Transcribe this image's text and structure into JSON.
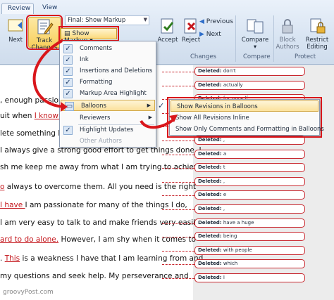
{
  "ribbon": {
    "tabs": [
      {
        "label": "Review"
      },
      {
        "label": "View"
      }
    ],
    "next_label": "Next",
    "track_changes_label": "Track Changes",
    "display_for_review": "Final: Show Markup",
    "show_markup_label": "Show Markup",
    "previous_label": "Previous",
    "next_change_label": "Next",
    "accept_label": "Accept",
    "reject_label": "Reject",
    "changes_group": "Changes",
    "compare_label": "Compare",
    "compare_group": "Compare",
    "block_authors_label": "Block Authors",
    "restrict_editing_label": "Restrict Editing",
    "protect_group": "Protect"
  },
  "markup_menu": {
    "items": [
      {
        "label": "Comments",
        "checked": true
      },
      {
        "label": "Ink",
        "checked": true
      },
      {
        "label": "Insertions and Deletions",
        "checked": true
      },
      {
        "label": "Formatting",
        "checked": true
      },
      {
        "label": "Markup Area Highlight",
        "checked": true
      },
      {
        "label": "Balloons",
        "checked": false
      },
      {
        "label": "Reviewers",
        "checked": false
      },
      {
        "label": "Highlight Updates",
        "checked": true
      },
      {
        "label": "Other Authors",
        "checked": false
      }
    ]
  },
  "balloons_submenu": {
    "items": [
      {
        "label": "Show Revisions in Balloons",
        "checked": true
      },
      {
        "label": "Show All Revisions Inline",
        "checked": false
      },
      {
        "label": "Show Only Comments and Formatting in Balloons",
        "checked": false
      }
    ]
  },
  "document": {
    "lines": [
      {
        "pre": ", enough  passion t",
        "ins": "",
        "post": ""
      },
      {
        "pre": "uit when ",
        "ins": "I know I c",
        "post": ""
      },
      {
        "pre": "",
        "ins": "",
        "post": "lete something I hav"
      },
      {
        "pre": "  I always give a strong good effort to get things done. I",
        "ins": "",
        "post": ""
      },
      {
        "pre": "sh me keep me away from what I am trying to achieve",
        "ins": "",
        "post": ""
      },
      {
        "pre": "",
        "ins": "o",
        "post": " always to overcome them. All you need is the right"
      },
      {
        "pre": "",
        "ins": " I have ",
        "post": "I am passionate for many of the things I do,"
      },
      {
        "pre": "I am very easy to talk to and make friends very easily. ",
        "ins": "this",
        "post": ""
      },
      {
        "pre": "",
        "ins": "ard to do alone.",
        "post": " However, I am shy when it comes to"
      },
      {
        "pre": ". ",
        "ins": "This",
        "post": " is a weakness I have that I am learning from and"
      },
      {
        "pre": "my questions and seek help. My perseverance and",
        "ins": "",
        "post": ""
      }
    ],
    "balloons": [
      {
        "label": "Deleted:",
        "text": "don't"
      },
      {
        "label": "Deleted:",
        "text": "actually"
      },
      {
        "label": "Deleted:",
        "text": "for myself"
      },
      {
        "label": "Deleted:",
        "text": "t"
      },
      {
        "label": "Deleted:",
        "text": "someone else may have, I generally don't even"
      },
      {
        "label": "Deleted:",
        "text": ","
      },
      {
        "label": "Deleted:",
        "text": "a"
      },
      {
        "label": "Deleted:",
        "text": "t"
      },
      {
        "label": "Deleted:",
        "text": ","
      },
      {
        "label": "Deleted:",
        "text": "e"
      },
      {
        "label": "Deleted:",
        "text": ","
      },
      {
        "label": "Deleted:",
        "text": "have a huge"
      },
      {
        "label": "Deleted:",
        "text": "being"
      },
      {
        "label": "Deleted:",
        "text": "with people"
      },
      {
        "label": "Deleted:",
        "text": "which"
      },
      {
        "label": "Deleted:",
        "text": "I"
      }
    ],
    "brand": "groovyPost.com"
  },
  "colors": {
    "accent_red": "#d9161b",
    "revision_red": "#c8262d",
    "ribbon_blue": "#d8e4f2"
  }
}
